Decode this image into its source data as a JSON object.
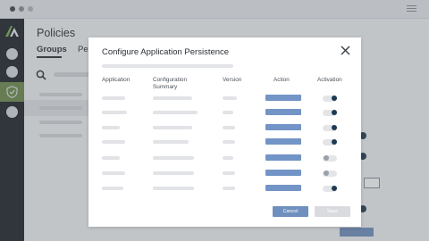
{
  "page": {
    "title": "Policies",
    "tabs": [
      {
        "label": "Groups"
      },
      {
        "label": "Per"
      }
    ]
  },
  "modal": {
    "title": "Configure Application Persistence",
    "columns": {
      "application": "Application",
      "configuration_summary": "Configuration Summary",
      "version": "Version",
      "action": "Action",
      "activation": "Activation"
    },
    "rows": [
      {
        "activation": "on"
      },
      {
        "activation": "on"
      },
      {
        "activation": "on"
      },
      {
        "activation": "on"
      },
      {
        "activation": "off"
      },
      {
        "activation": "off"
      },
      {
        "activation": "on"
      }
    ],
    "cancel_label": "Cancel",
    "save_label": "Save"
  },
  "colors": {
    "sidebar": "#1d2329",
    "sidebar_active": "#6e8a4a",
    "primary_button": "#6f8fbf",
    "action_button": "#7394c6",
    "toggle_on_knob": "#1f3a52",
    "disabled_button": "#d9dbde"
  },
  "icons": {
    "logo": "brand-logo-icon",
    "policies_nav": "shield-icon",
    "search": "search-icon",
    "close": "close-icon",
    "menu": "hamburger-menu-icon"
  }
}
